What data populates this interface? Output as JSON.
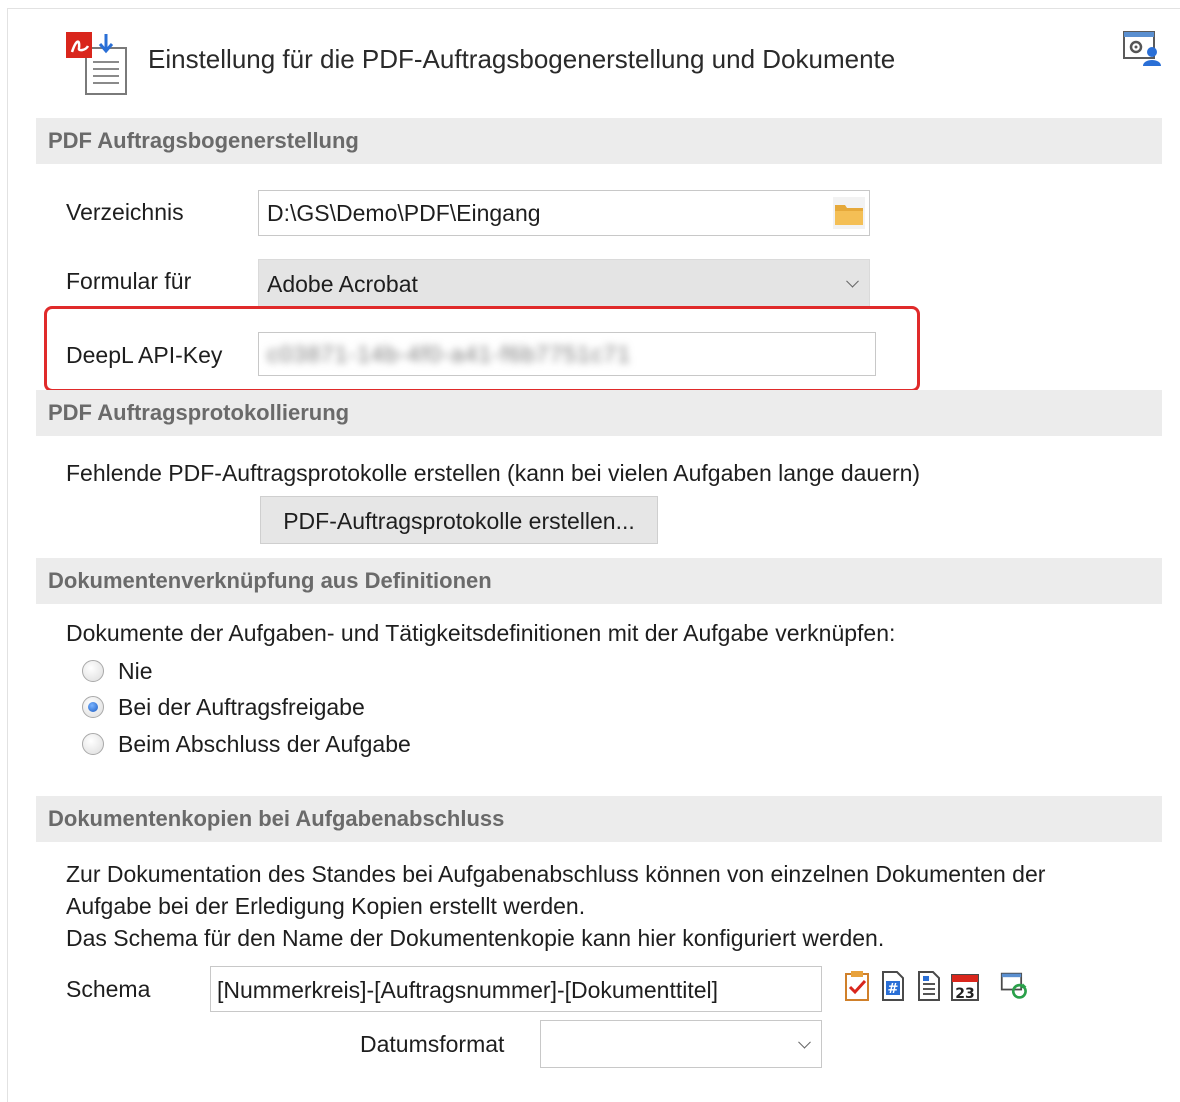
{
  "header": {
    "title": "Einstellung für die PDF-Auftragsbogenerstellung und Dokumente",
    "title_icon": "pdf-document-icon",
    "settings_icon": "user-settings-icon"
  },
  "pdf_section": {
    "heading": "PDF Auftragsbogenerstellung",
    "directory_label": "Verzeichnis",
    "directory_value": "D:\\GS\\Demo\\PDF\\Eingang",
    "folder_icon": "folder-icon",
    "form_label": "Formular für",
    "form_value": "Adobe Acrobat",
    "deepl_label": "DeepL API-Key",
    "deepl_value": "c03871-14b-4f0-a41-f6b7751c71",
    "highlight_color": "#e02a2a"
  },
  "protocol_section": {
    "heading": "PDF Auftragsprotokollierung",
    "description": "Fehlende PDF-Auftragsprotokolle erstellen (kann bei vielen Aufgaben lange dauern)",
    "button_label": "PDF-Auftragsprotokolle erstellen..."
  },
  "link_section": {
    "heading": "Dokumentenverknüpfung aus Definitionen",
    "description": "Dokumente der Aufgaben- und Tätigkeitsdefinitionen mit der Aufgabe verknüpfen:",
    "options": [
      {
        "label": "Nie",
        "checked": false
      },
      {
        "label": "Bei der Auftragsfreigabe",
        "checked": true
      },
      {
        "label": "Beim Abschluss der Aufgabe",
        "checked": false
      }
    ]
  },
  "copy_section": {
    "heading": "Dokumentenkopien bei Aufgabenabschluss",
    "lines": [
      "Zur Dokumentation des Standes bei Aufgabenabschluss können von einzelnen Dokumenten der",
      "Aufgabe bei der Erledigung Kopien erstellt werden.",
      "Das Schema für den Name der Dokumentenkopie kann hier konfiguriert werden."
    ],
    "schema_label": "Schema",
    "schema_value": "[Nummerkreis]-[Auftragsnummer]-[Dokumenttitel]",
    "date_format_label": "Datumsformat",
    "date_format_value": "",
    "calendar_day": "23",
    "toolbar_icons": [
      "checklist-icon",
      "number-document-icon",
      "text-document-icon",
      "calendar-icon",
      "refresh-icon"
    ]
  }
}
